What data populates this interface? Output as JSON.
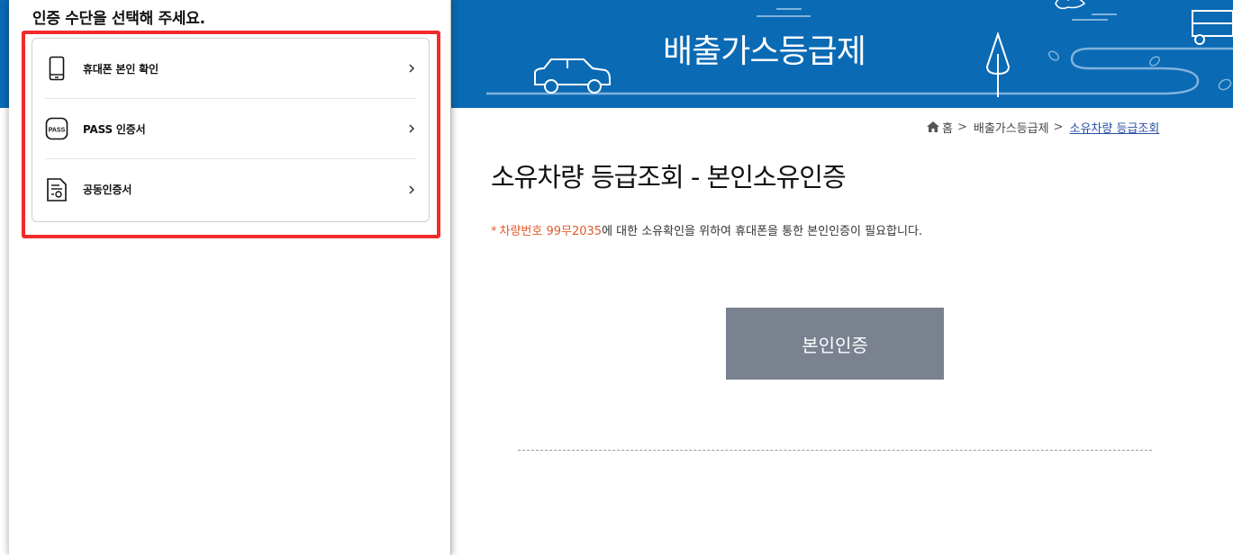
{
  "banner": {
    "title": "배출가스등급제"
  },
  "breadcrumb": {
    "items": [
      "홈",
      "배출가스등급제",
      "소유차량 등급조회"
    ]
  },
  "main": {
    "page_title": "소유차량 등급조회 - 본인소유인증",
    "notice": {
      "star": "*",
      "highlight": "차량번호 99무2035",
      "text": "에 대한 소유확인을 위하여 휴대폰을 통한 본인인증이 필요합니다."
    },
    "verify_button_label": "본인인증"
  },
  "popup": {
    "heading": "인증 수단을 선택해 주세요.",
    "methods": [
      {
        "label": "휴대폰 본인 확인",
        "icon": "smartphone-icon"
      },
      {
        "label": "PASS 인증서",
        "icon": "pass-icon",
        "icon_text": "PASS"
      },
      {
        "label": "공동인증서",
        "icon": "certificate-icon"
      }
    ]
  },
  "colors": {
    "banner_blue": "#0a6ab4",
    "highlight_red": "#f22a2a",
    "accent_orange": "#e25a2c",
    "button_gray": "#7a818f",
    "link_blue": "#2a4ea6"
  }
}
